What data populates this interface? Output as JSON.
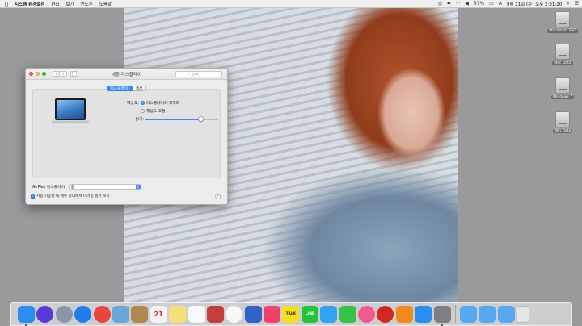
{
  "menubar": {
    "apple_icon": "apple-logo-icon",
    "app_name": "시스템 환경설정",
    "items": [
      "편집",
      "보기",
      "윈도우",
      "도움말"
    ],
    "battery": "37%",
    "input_source": "A",
    "clock": "9월 21일 (수) 오후 2:31:20"
  },
  "desktop": {
    "drives": [
      {
        "label": "Macintosh SSD"
      },
      {
        "label": "Mac Data"
      },
      {
        "label": "Windows 7"
      },
      {
        "label": "Win Data"
      }
    ]
  },
  "window": {
    "title": "내장 디스플레이",
    "search_placeholder": "검색",
    "tabs": [
      {
        "label": "디스플레이",
        "active": true
      },
      {
        "label": "색상",
        "active": false
      }
    ],
    "resolution": {
      "label": "해상도:",
      "options": [
        {
          "label": "디스플레이에 최적화",
          "selected": true
        },
        {
          "label": "해상도 조절",
          "selected": false
        }
      ]
    },
    "brightness": {
      "label": "밝기:",
      "value": 0.75
    },
    "airplay": {
      "label": "AirPlay 디스플레이:",
      "selected": "끔"
    },
    "mirror_option": {
      "label": "사용 가능할 때 메뉴 막대에서 미러링 옵션 보기",
      "checked": true
    },
    "help": "?"
  },
  "dock": {
    "apps": [
      {
        "name": "finder",
        "color": "#2a8ef0",
        "running": true
      },
      {
        "name": "siri",
        "color": "#5a3ad6",
        "running": false
      },
      {
        "name": "launchpad",
        "color": "#8b96a6",
        "running": false
      },
      {
        "name": "safari",
        "color": "#1f7ee8",
        "running": false
      },
      {
        "name": "chrome",
        "color": "#e8453c",
        "running": false
      },
      {
        "name": "preview",
        "color": "#6aa6d8",
        "running": false
      },
      {
        "name": "contacts",
        "color": "#b08850",
        "running": false
      },
      {
        "name": "calendar",
        "color": "#f4f4f4",
        "text": "21",
        "running": false
      },
      {
        "name": "notes",
        "color": "#f6e07a",
        "running": false
      },
      {
        "name": "reminders",
        "color": "#f9f9f9",
        "running": false
      },
      {
        "name": "photo-booth",
        "color": "#c33d3d",
        "running": false
      },
      {
        "name": "photos",
        "color": "#f7f7f7",
        "running": false
      },
      {
        "name": "keynote",
        "color": "#2f63c9",
        "running": false
      },
      {
        "name": "camera",
        "color": "#f2406b",
        "running": false
      },
      {
        "name": "kakaotalk",
        "color": "#f7df1e",
        "text": "TALK",
        "running": false
      },
      {
        "name": "line",
        "color": "#27c23a",
        "text": "LINE",
        "running": false
      },
      {
        "name": "messages",
        "color": "#2fa3f0",
        "running": false
      },
      {
        "name": "facetime",
        "color": "#36c24a",
        "running": false
      },
      {
        "name": "itunes",
        "color": "#f05a8c",
        "running": false
      },
      {
        "name": "music",
        "color": "#d2271f",
        "running": false
      },
      {
        "name": "ibooks",
        "color": "#f08a1c",
        "running": false
      },
      {
        "name": "app-store",
        "color": "#2a8ef0",
        "running": false
      },
      {
        "name": "system-preferences",
        "color": "#7e7e84",
        "running": true
      }
    ],
    "stacks": [
      {
        "name": "applications-folder",
        "color": "#58a8f0"
      },
      {
        "name": "documents-folder",
        "color": "#58a8f0"
      },
      {
        "name": "downloads-folder",
        "color": "#58a8f0"
      },
      {
        "name": "trash",
        "color": "#e6e6e6"
      }
    ]
  }
}
